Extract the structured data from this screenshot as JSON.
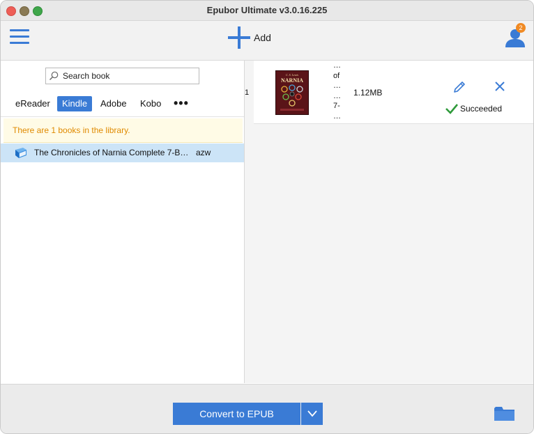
{
  "window": {
    "title": "Epubor Ultimate v3.0.16.225"
  },
  "toolbar": {
    "add_label": "Add",
    "notification_count": "2"
  },
  "library": {
    "search_placeholder": "Search book",
    "tabs": [
      {
        "label": "eReader",
        "active": false
      },
      {
        "label": "Kindle",
        "active": true
      },
      {
        "label": "Adobe",
        "active": false
      },
      {
        "label": "Kobo",
        "active": false
      }
    ],
    "more_label": "•••",
    "notice": "There are 1 books in the library.",
    "books": [
      {
        "title": "The Chronicles of Narnia Complete 7-B…",
        "format": "azw"
      }
    ]
  },
  "conversion": {
    "rows": [
      {
        "index": "1",
        "title_lines": [
          "…",
          "of",
          "…",
          "…",
          "7-",
          "…"
        ],
        "size": "1.12MB",
        "status": "Succeeded",
        "cover": {
          "author": "C. S. Lewis",
          "title": "NARNIA"
        }
      }
    ]
  },
  "bottom": {
    "convert_label": "Convert to EPUB"
  },
  "colors": {
    "accent": "#3a7bd5",
    "notice_text": "#e08a00",
    "notice_bg": "#fffbe6",
    "selected_row": "#cce4f7",
    "success": "#2e9a3a",
    "badge": "#f08a24"
  },
  "icons": [
    "hamburger-menu-icon",
    "plus-icon",
    "user-icon",
    "search-icon",
    "book-icon",
    "pencil-icon",
    "close-icon",
    "checkmark-icon",
    "chevron-down-icon",
    "folder-icon"
  ]
}
